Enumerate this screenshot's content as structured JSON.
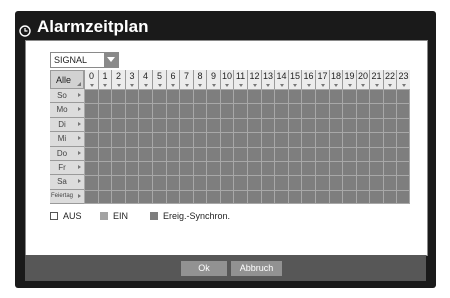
{
  "window": {
    "title": "Alarmzeitplan"
  },
  "signal_select": {
    "value": "SIGNAL"
  },
  "grid": {
    "corner_label": "Alle",
    "hours": [
      "0",
      "1",
      "2",
      "3",
      "4",
      "5",
      "6",
      "7",
      "8",
      "9",
      "10",
      "11",
      "12",
      "13",
      "14",
      "15",
      "16",
      "17",
      "18",
      "19",
      "20",
      "21",
      "22",
      "23"
    ],
    "days": [
      "So",
      "Mo",
      "Di",
      "Mi",
      "Do",
      "Fr",
      "Sa",
      "Feiertag"
    ]
  },
  "legend": {
    "off_label": "AUS",
    "on_label": "EIN",
    "event_label": "Ereig.-Synchron.",
    "colors": {
      "off": "#ffffff",
      "on": "#a3a3a3",
      "event": "#7e7e7e"
    }
  },
  "buttons": {
    "ok_label": "Ok",
    "cancel_label": "Abbruch"
  }
}
